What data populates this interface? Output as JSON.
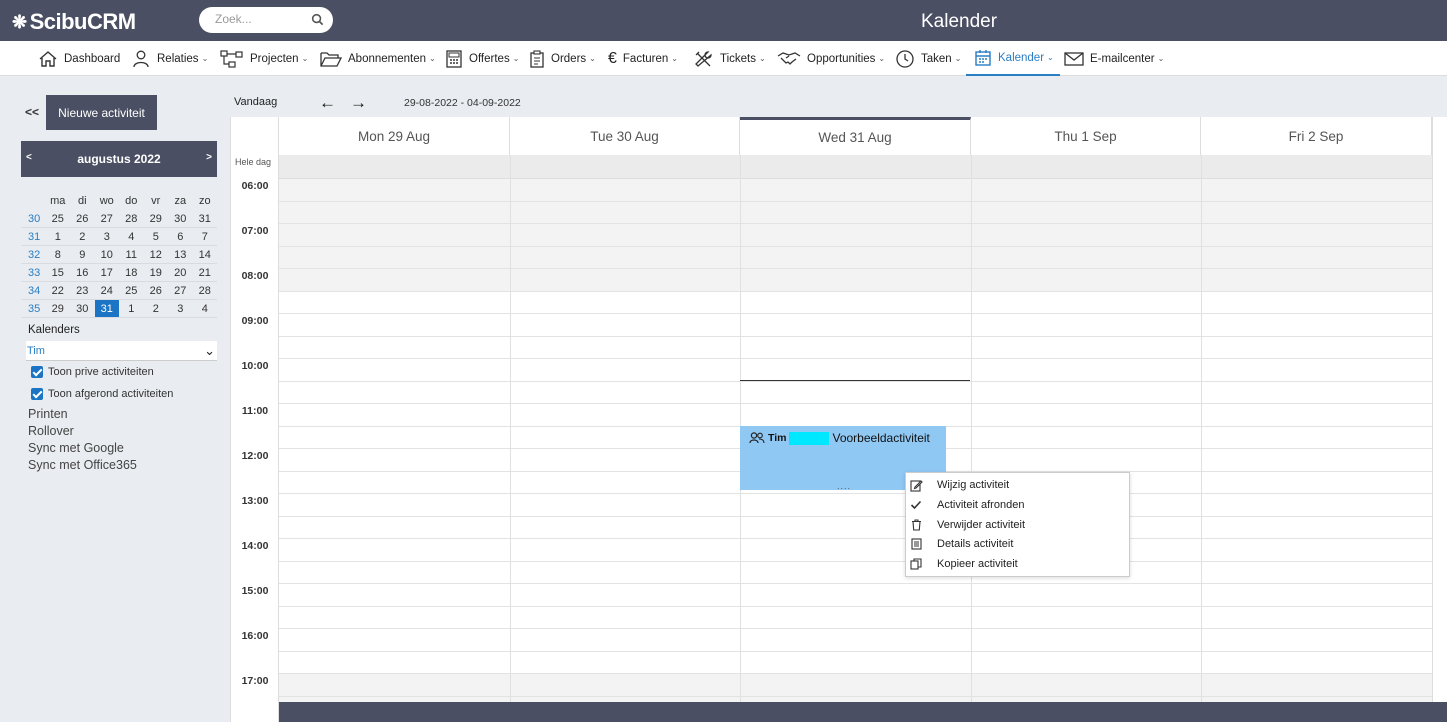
{
  "app": {
    "logo": "ScibuCRM",
    "title": "Kalender"
  },
  "search": {
    "placeholder": "Zoek..."
  },
  "nav": {
    "items": [
      {
        "label": "Dashboard"
      },
      {
        "label": "Relaties"
      },
      {
        "label": "Projecten"
      },
      {
        "label": "Abonnementen"
      },
      {
        "label": "Offertes"
      },
      {
        "label": "Orders"
      },
      {
        "label": "Facturen"
      },
      {
        "label": "Tickets"
      },
      {
        "label": "Opportunities"
      },
      {
        "label": "Taken"
      },
      {
        "label": "Kalender"
      },
      {
        "label": "E-mailcenter"
      }
    ]
  },
  "sidebar": {
    "collapse": "<<",
    "new_activity": "Nieuwe activiteit",
    "month_label": "augustus 2022",
    "prev": "<",
    "next": ">",
    "weekdays": [
      "ma",
      "di",
      "wo",
      "do",
      "vr",
      "za",
      "zo"
    ],
    "weeks": [
      {
        "wk": "30",
        "days": [
          "25",
          "26",
          "27",
          "28",
          "29",
          "30",
          "31"
        ]
      },
      {
        "wk": "31",
        "days": [
          "1",
          "2",
          "3",
          "4",
          "5",
          "6",
          "7"
        ]
      },
      {
        "wk": "32",
        "days": [
          "8",
          "9",
          "10",
          "11",
          "12",
          "13",
          "14"
        ]
      },
      {
        "wk": "33",
        "days": [
          "15",
          "16",
          "17",
          "18",
          "19",
          "20",
          "21"
        ]
      },
      {
        "wk": "34",
        "days": [
          "22",
          "23",
          "24",
          "25",
          "26",
          "27",
          "28"
        ]
      },
      {
        "wk": "35",
        "days": [
          "29",
          "30",
          "31",
          "1",
          "2",
          "3",
          "4"
        ]
      }
    ],
    "selected_day": "31",
    "calendars_label": "Kalenders",
    "calendar_selected": "Tim",
    "show_private": "Toon prive activiteiten",
    "show_completed": "Toon afgerond activiteiten",
    "links": [
      "Printen",
      "Rollover",
      "Sync met Google",
      "Sync met Office365"
    ]
  },
  "toolbar": {
    "today": "Vandaag",
    "back_arrow": "←",
    "forward_arrow": "→",
    "range": "29-08-2022 - 04-09-2022"
  },
  "calendar": {
    "all_day_label": "Hele dag",
    "days": [
      "Mon 29 Aug",
      "Tue 30 Aug",
      "Wed 31 Aug",
      "Thu 1 Sep",
      "Fri 2 Sep"
    ],
    "hours": [
      "06:00",
      "07:00",
      "08:00",
      "09:00",
      "10:00",
      "11:00",
      "12:00",
      "13:00",
      "14:00",
      "15:00",
      "16:00",
      "17:00"
    ]
  },
  "event": {
    "owner": "Tim",
    "title": "Voorbeeldactiviteit",
    "handle": "....",
    "color": "#90c8f4"
  },
  "context_menu": {
    "items": [
      "Wijzig activiteit",
      "Activiteit afronden",
      "Verwijder activiteit",
      "Details activiteit",
      "Kopieer activiteit"
    ]
  },
  "colors": {
    "header": "#4a4f63",
    "accent": "#2a7ec4",
    "event": "#90c8f4"
  }
}
